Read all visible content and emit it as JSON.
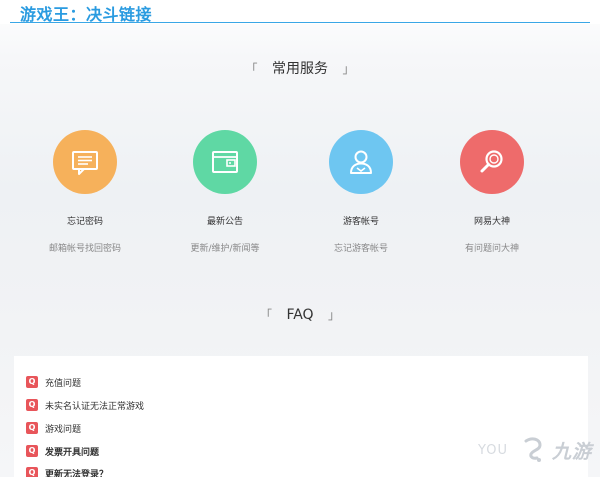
{
  "header": {
    "title": "游戏王：决斗链接",
    "accent": "#2a9be0"
  },
  "services": {
    "title": "常用服务",
    "bracket_open": "「",
    "bracket_close": "」",
    "items": [
      {
        "name": "忘记密码",
        "desc": "邮箱帐号找回密码",
        "icon": "message-icon",
        "color": "#f6b15b"
      },
      {
        "name": "最新公告",
        "desc": "更新/维护/新闻等",
        "icon": "wallet-icon",
        "color": "#5fd8a4"
      },
      {
        "name": "游客帐号",
        "desc": "忘记游客帐号",
        "icon": "user-icon",
        "color": "#6ec6f1"
      },
      {
        "name": "网易大神",
        "desc": "有问题问大神",
        "icon": "magnifier-icon",
        "color": "#ee6b6b"
      }
    ]
  },
  "faq": {
    "title": "FAQ",
    "bracket_open": "「",
    "bracket_close": "」",
    "badge_letter": "Q",
    "badge_color": "#e8555a",
    "items": [
      {
        "text": "充值问题",
        "bold": false
      },
      {
        "text": "未实名认证无法正常游戏",
        "bold": false
      },
      {
        "text": "游戏问题",
        "bold": false
      },
      {
        "text": "发票开具问题",
        "bold": true
      },
      {
        "text": "更新无法登录？",
        "bold": true
      }
    ]
  },
  "watermark": {
    "prefix": "YOU",
    "brand": "九游"
  }
}
